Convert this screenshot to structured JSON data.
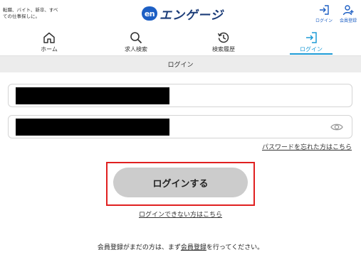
{
  "header": {
    "tagline": "転職、バイト、新卒、すべての仕事探しに。",
    "logo_mark": "en",
    "logo_text": "エンゲージ",
    "actions": {
      "login_label": "ログイン",
      "register_label": "会員登録"
    }
  },
  "nav": {
    "items": [
      {
        "label": "ホーム",
        "icon": "home-icon"
      },
      {
        "label": "求人検索",
        "icon": "search-icon"
      },
      {
        "label": "検索履歴",
        "icon": "history-icon"
      },
      {
        "label": "ログイン",
        "icon": "login-icon",
        "active": true
      }
    ]
  },
  "section": {
    "title": "ログイン"
  },
  "form": {
    "email_value": "",
    "password_value": "",
    "forgot_password": "パスワードを忘れた方はこちら",
    "submit_label": "ログインする",
    "cannot_login": "ログインできない方はこちら"
  },
  "footer": {
    "register_prefix": "会員登録がまだの方は、まず",
    "register_link": "会員登録",
    "register_suffix": "を行ってください。"
  },
  "colors": {
    "brand_blue": "#1d5fc4",
    "active_tab": "#1d9bd6",
    "highlight_red": "#e02020",
    "button_gray": "#cccccc"
  }
}
